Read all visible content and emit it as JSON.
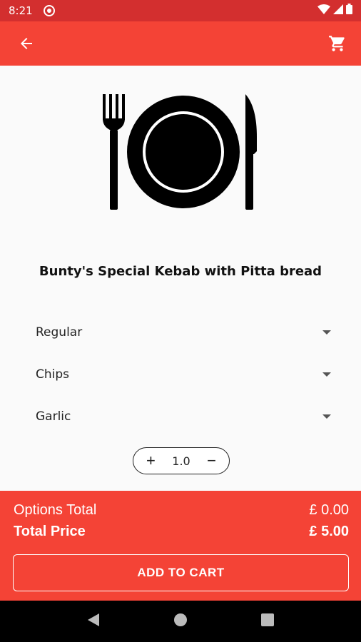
{
  "status_bar": {
    "time": "8:21"
  },
  "item": {
    "title": "Bunty's Special Kebab with Pitta bread"
  },
  "options": [
    {
      "label": "Regular"
    },
    {
      "label": "Chips"
    },
    {
      "label": "Garlic"
    }
  ],
  "quantity": {
    "value": "1.0",
    "increment_label": "+",
    "decrement_label": "−"
  },
  "totals": {
    "options_label": "Options Total",
    "options_value": "£ 0.00",
    "total_label": "Total Price",
    "total_value": "£ 5.00"
  },
  "actions": {
    "add_to_cart_label": "ADD TO CART"
  },
  "icons": {
    "back": "back-arrow-icon",
    "cart": "shopping-cart-icon",
    "hero": "plate-cutlery-icon"
  },
  "colors": {
    "primary": "#f44336",
    "status_bar": "#d32f2f"
  }
}
